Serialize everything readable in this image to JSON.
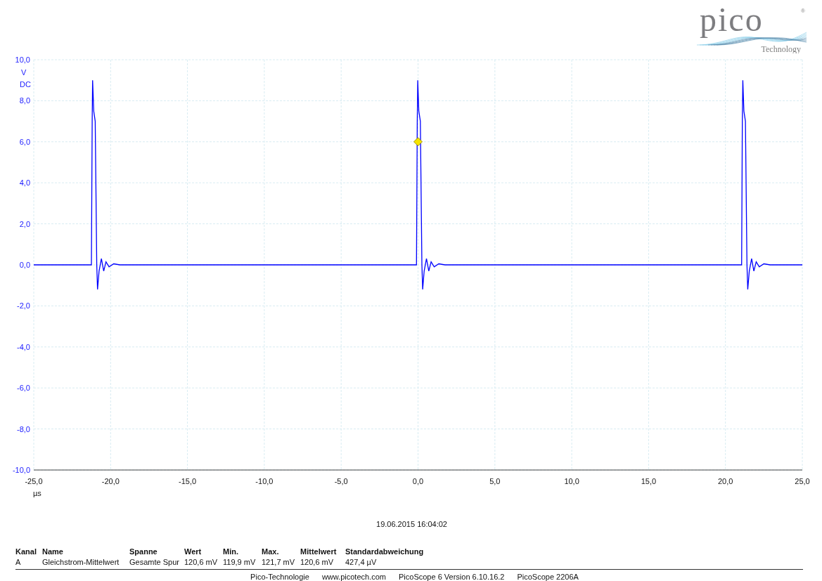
{
  "logo": {
    "wordmark": "pico",
    "registered": "®",
    "tagline": "Technology"
  },
  "chart": {
    "coupling": "DC",
    "chart_data": {
      "type": "line",
      "grid": true,
      "xlabel": "µs",
      "ylabel": "V",
      "xlim": [
        -25,
        25
      ],
      "ylim": [
        -10,
        10
      ],
      "xticks": [
        {
          "value": -25,
          "label": "-25,0"
        },
        {
          "value": -20,
          "label": "-20,0"
        },
        {
          "value": -15,
          "label": "-15,0"
        },
        {
          "value": -10,
          "label": "-10,0"
        },
        {
          "value": -5,
          "label": "-5,0"
        },
        {
          "value": 0,
          "label": "0,0"
        },
        {
          "value": 5,
          "label": "5,0"
        },
        {
          "value": 10,
          "label": "10,0"
        },
        {
          "value": 15,
          "label": "15,0"
        },
        {
          "value": 20,
          "label": "20,0"
        },
        {
          "value": 25,
          "label": "25,0"
        }
      ],
      "yticks": [
        {
          "value": 10,
          "label": "10,0"
        },
        {
          "value": 8,
          "label": "8,0"
        },
        {
          "value": 6,
          "label": "6,0"
        },
        {
          "value": 4,
          "label": "4,0"
        },
        {
          "value": 2,
          "label": "2,0"
        },
        {
          "value": 0,
          "label": "0,0"
        },
        {
          "value": -2,
          "label": "-2,0"
        },
        {
          "value": -4,
          "label": "-4,0"
        },
        {
          "value": -6,
          "label": "-6,0"
        },
        {
          "value": -8,
          "label": "-8,0"
        },
        {
          "value": -10,
          "label": "-10,0"
        }
      ],
      "x": [
        -25,
        -21.25,
        -21.2,
        -21.17,
        -21.1,
        -21.0,
        -20.9,
        -20.85,
        -20.75,
        -20.6,
        -20.45,
        -20.3,
        -20.1,
        -19.8,
        -19.4,
        -0.1,
        -0.05,
        -0.02,
        0.05,
        0.15,
        0.25,
        0.3,
        0.4,
        0.55,
        0.7,
        0.85,
        1.05,
        1.35,
        1.75,
        21.05,
        21.1,
        21.13,
        21.2,
        21.3,
        21.4,
        21.45,
        21.55,
        21.7,
        21.85,
        22.0,
        22.2,
        22.5,
        22.9,
        25
      ],
      "series": [
        {
          "color": "#0000ff",
          "values": [
            0,
            0,
            7,
            9,
            7.5,
            7,
            0,
            -1.2,
            -0.3,
            0.3,
            -0.3,
            0.15,
            -0.1,
            0.05,
            0,
            0,
            7,
            9,
            7.5,
            7,
            0,
            -1.2,
            -0.3,
            0.3,
            -0.3,
            0.15,
            -0.1,
            0.05,
            0,
            0,
            7,
            9,
            7.5,
            7,
            0,
            -1.2,
            -0.3,
            0.3,
            -0.3,
            0.15,
            -0.1,
            0.05,
            0,
            0
          ]
        }
      ]
    }
  },
  "timestamp": "19.06.2015 16:04:02",
  "table": {
    "columns": [
      "Kanal",
      "Name",
      "Spanne",
      "Wert",
      "Min.",
      "Max.",
      "Mittelwert",
      "Standardabweichung"
    ],
    "rows": [
      [
        "A",
        "Gleichstrom-Mittelwert",
        "Gesamte Spur",
        "120,6 mV",
        "119,9 mV",
        "121,7 mV",
        "120,6 mV",
        "427,4 µV"
      ]
    ]
  },
  "footer": [
    "Pico-Technologie",
    "www.picotech.com",
    "PicoScope 6 Version 6.10.16.2",
    "PicoScope 2206A"
  ]
}
